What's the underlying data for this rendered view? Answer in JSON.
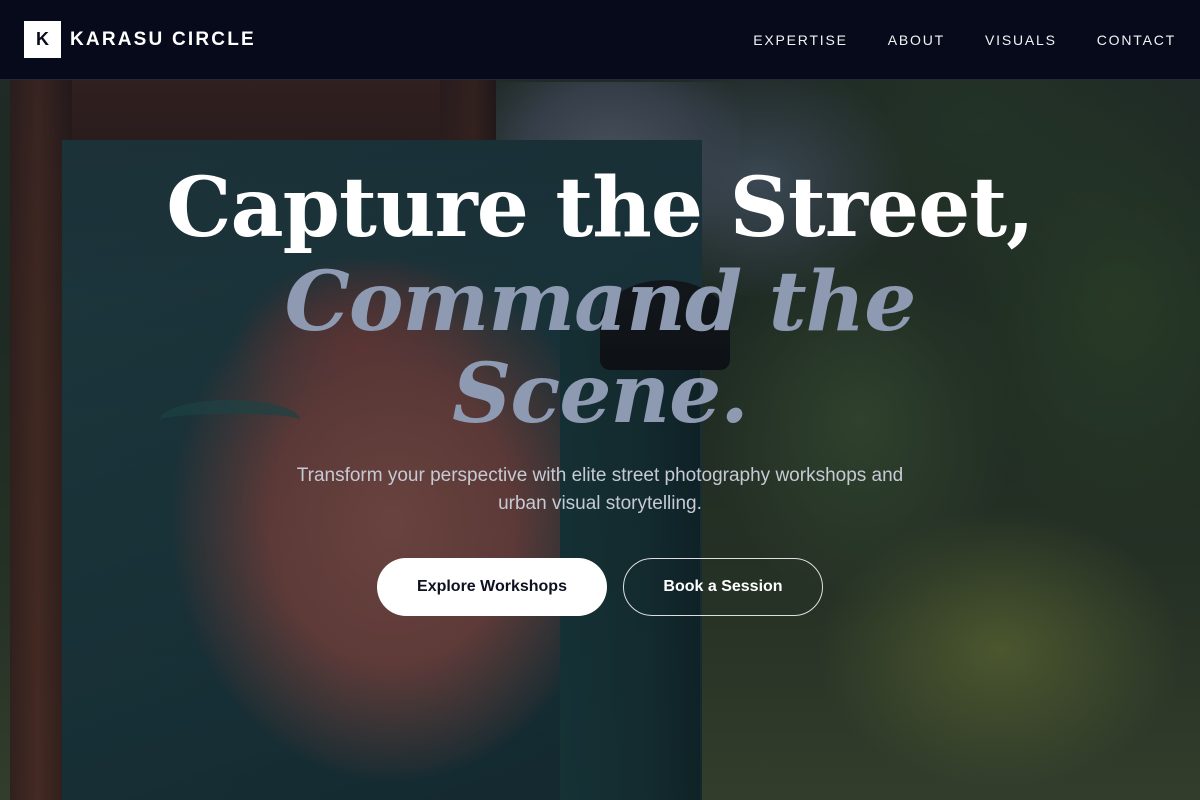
{
  "brand": {
    "mark": "K",
    "name": "KARASU CIRCLE"
  },
  "nav": {
    "items": [
      {
        "label": "EXPERTISE"
      },
      {
        "label": "ABOUT"
      },
      {
        "label": "VISUALS"
      },
      {
        "label": "CONTACT"
      }
    ]
  },
  "hero": {
    "headline_line1": "Capture the Street,",
    "headline_line2": "Command the Scene.",
    "subtitle": "Transform your perspective with elite street photography workshops and urban visual storytelling.",
    "primary_cta": "Explore Workshops",
    "secondary_cta": "Book a Session"
  },
  "colors": {
    "nav_background": "#070a1a",
    "headline_primary": "#ffffff",
    "headline_accent": "#8d9ab1",
    "button_primary_bg": "#ffffff"
  }
}
